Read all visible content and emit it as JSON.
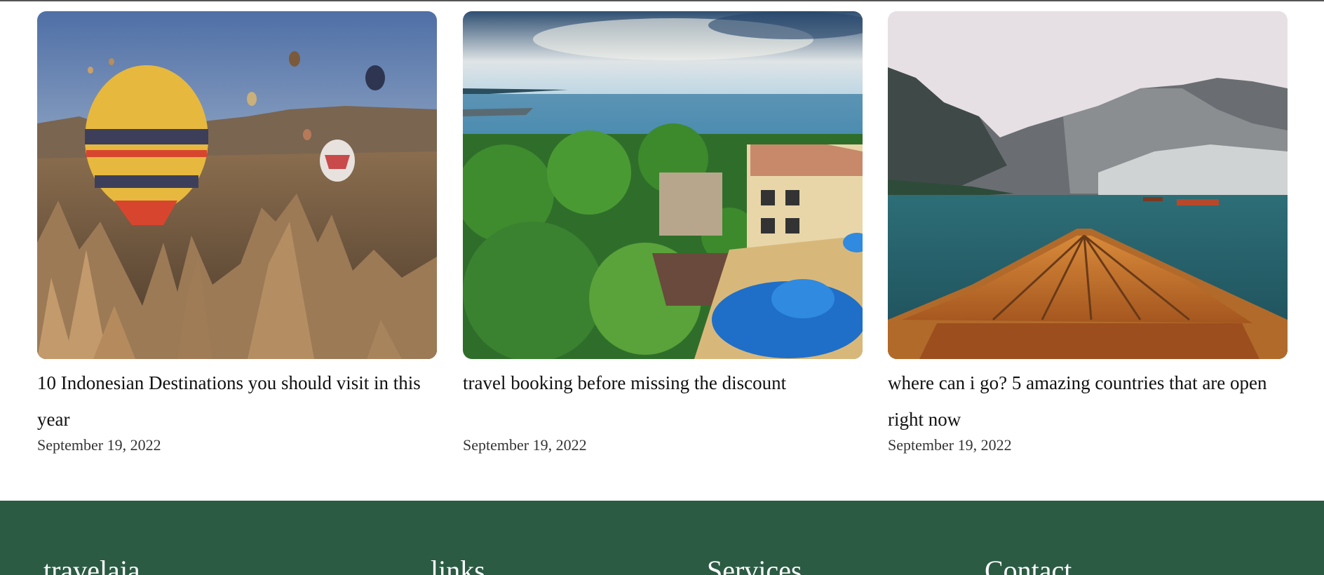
{
  "posts": [
    {
      "title": "10 Indonesian Destinations you should visit in this year",
      "date": "September 19, 2022",
      "image": "hot-air-balloons-cappadocia-photo"
    },
    {
      "title": "travel booking before missing the discount",
      "date": "September 19, 2022",
      "image": "tropical-resort-pool-ocean-photo"
    },
    {
      "title": "where can i go? 5 amazing countries that are open right now",
      "date": "September 19, 2022",
      "image": "wooden-boat-mountain-lake-photo"
    }
  ],
  "footer": {
    "brand": "travelaja",
    "links_heading": "links",
    "services_heading": "Services",
    "contact_heading": "Contact",
    "background": "#2c5b44"
  }
}
